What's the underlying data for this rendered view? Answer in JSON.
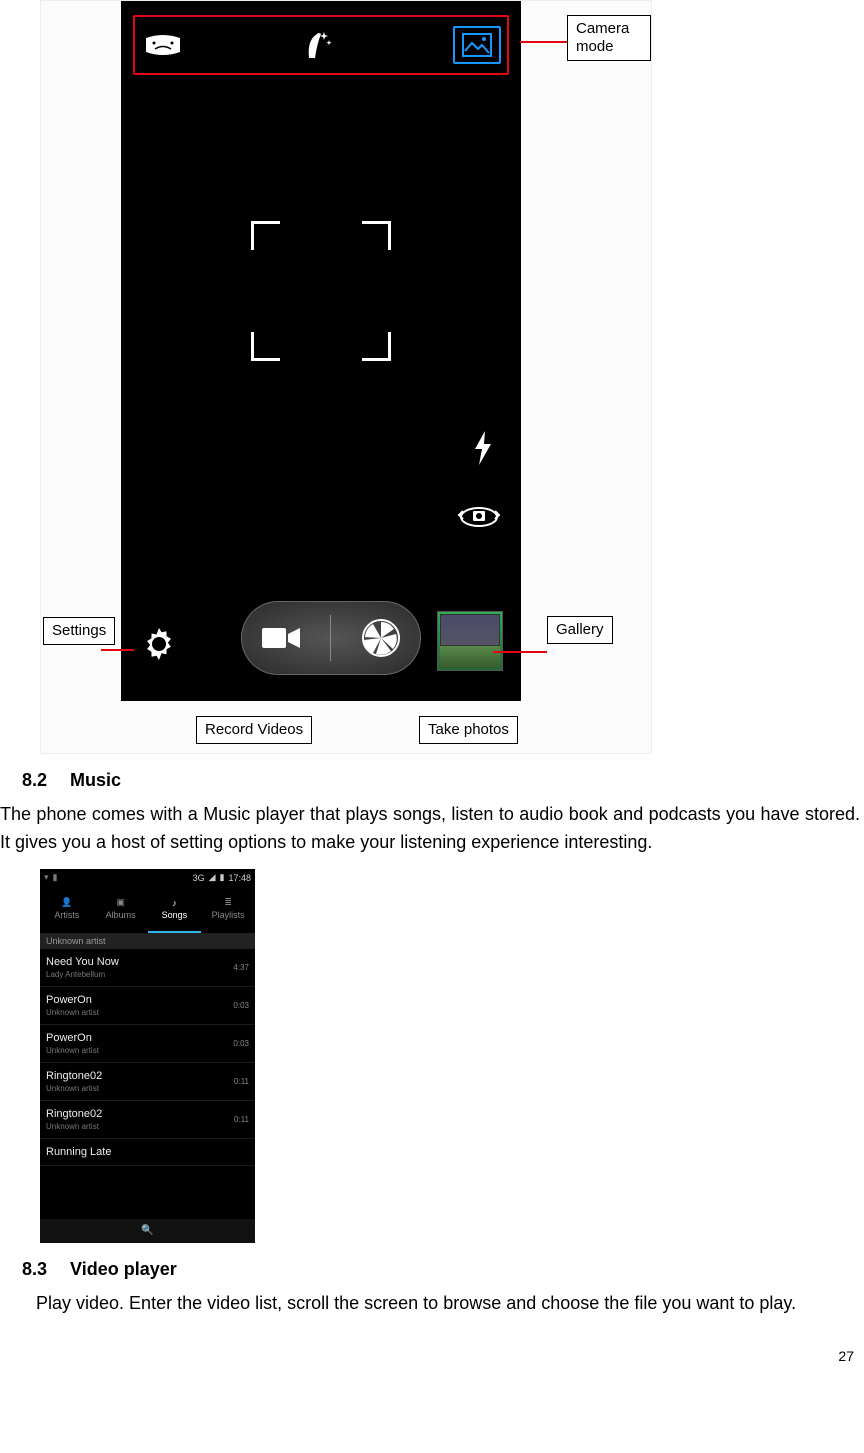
{
  "camera": {
    "labels": {
      "camera_mode": "Camera mode",
      "settings": "Settings",
      "gallery": "Gallery",
      "record_videos": "Record Videos",
      "take_photos": "Take photos"
    }
  },
  "section_music": {
    "number": "8.2",
    "title": "Music",
    "body": "The phone comes with a Music player that plays songs, listen to audio book and podcasts you have stored. It gives you a host of setting options to make your listening experience interesting."
  },
  "music_app": {
    "status_time": "17:48",
    "status_network": "3G",
    "tabs": [
      "Artists",
      "Albums",
      "Songs",
      "Playlists"
    ],
    "active_tab": 2,
    "group_header": "Unknown artist",
    "songs": [
      {
        "title": "Need You Now",
        "artist": "Lady Antebellum",
        "duration": "4:37"
      },
      {
        "title": "PowerOn",
        "artist": "Unknown artist",
        "duration": "0:03"
      },
      {
        "title": "PowerOn",
        "artist": "Unknown artist",
        "duration": "0:03"
      },
      {
        "title": "Ringtone02",
        "artist": "Unknown artist",
        "duration": "0:11"
      },
      {
        "title": "Ringtone02",
        "artist": "Unknown artist",
        "duration": "0:11"
      },
      {
        "title": "Running Late",
        "artist": "",
        "duration": ""
      }
    ]
  },
  "section_video": {
    "number": "8.3",
    "title": "Video player",
    "body": "Play video. Enter the video list, scroll the screen to browse and choose the file you want to play."
  },
  "page_number": "27"
}
